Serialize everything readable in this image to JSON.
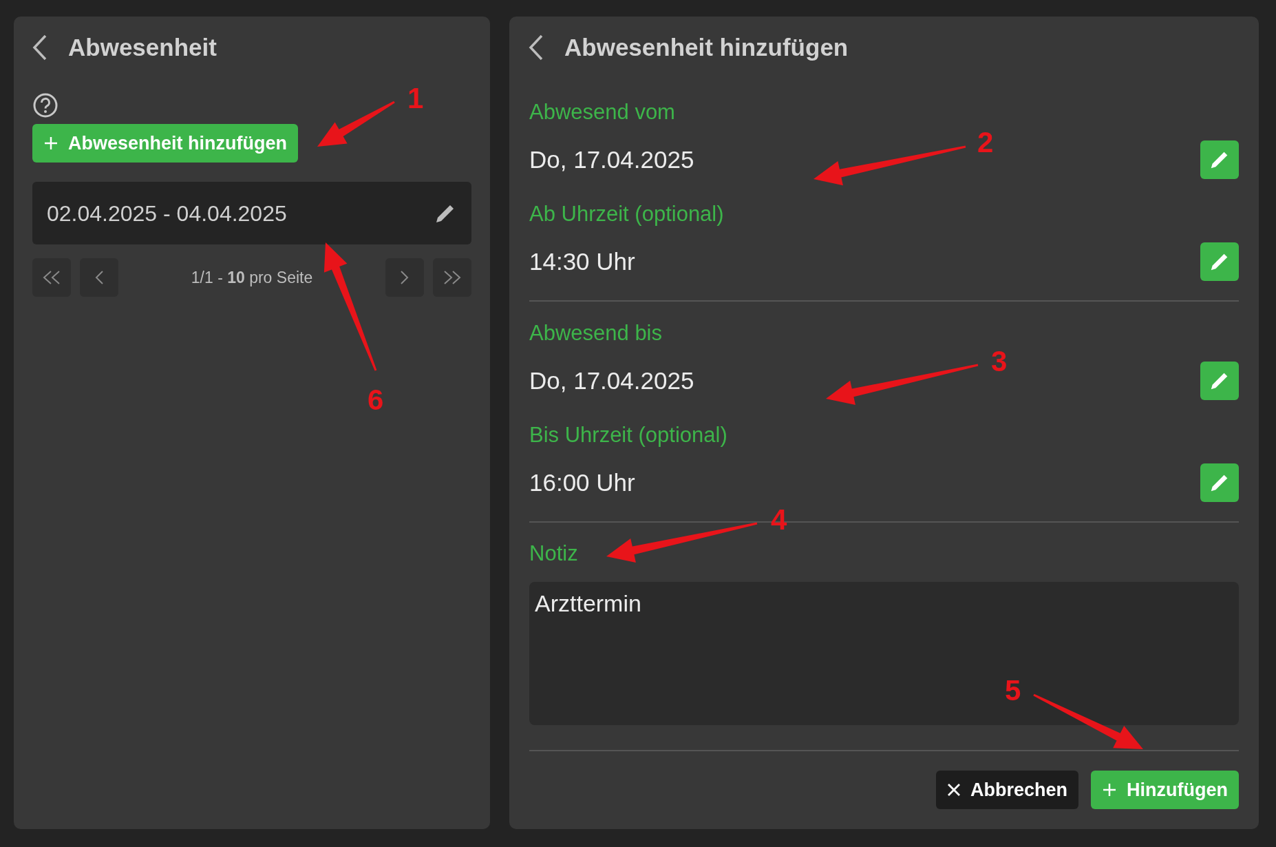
{
  "left_panel": {
    "title": "Abwesenheit",
    "add_button": "Abwesenheit hinzufügen",
    "entries": [
      {
        "range": "02.04.2025 - 04.04.2025"
      }
    ],
    "pagination": {
      "summary": "1/1 - **10** pro Seite"
    }
  },
  "right_panel": {
    "title": "Abwesenheit hinzufügen",
    "sections": [
      {
        "fields": [
          {
            "label": "Abwesend vom",
            "value": "Do, 17.04.2025"
          },
          {
            "label": "Ab Uhrzeit (optional)",
            "value": "14:30 Uhr"
          }
        ]
      },
      {
        "fields": [
          {
            "label": "Abwesend bis",
            "value": "Do, 17.04.2025"
          },
          {
            "label": "Bis Uhrzeit (optional)",
            "value": "16:00 Uhr"
          }
        ]
      }
    ],
    "note": {
      "label": "Notiz",
      "value": "Arzttermin"
    },
    "cancel_button": "Abbrechen",
    "submit_button": "Hinzufügen"
  },
  "annotations": [
    {
      "label": "1"
    },
    {
      "label": "2"
    },
    {
      "label": "3"
    },
    {
      "label": "4"
    },
    {
      "label": "5"
    },
    {
      "label": "6"
    }
  ]
}
